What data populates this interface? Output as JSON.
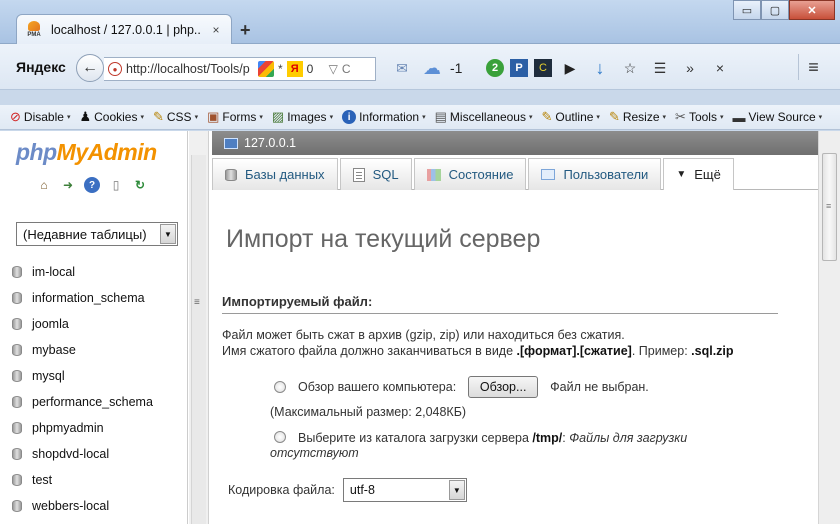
{
  "browser": {
    "tab_title": "localhost / 127.0.0.1 | php...",
    "tab_close": "×",
    "new_tab": "+",
    "favicon_text": "PMA",
    "window_controls": {
      "minimize": "▭",
      "maximize": "▢",
      "close": "✕"
    },
    "brand": "Яндекс",
    "back": "←",
    "url": "http://localhost/Tools/p",
    "url_icons": {
      "site": "●",
      "star": "*",
      "ya": "Я",
      "count": "0",
      "dropdown": "▽",
      "reload": "C"
    },
    "toolbar": {
      "mail": "✉",
      "weather": "☁",
      "weather_value": "-1",
      "green_badge": "2",
      "p_badge": "P",
      "c_badge": "C",
      "play": "▶",
      "download": "↓",
      "bookmark": "☆",
      "clipboard": "☰",
      "more": "»",
      "close": "×"
    },
    "menu": "≡"
  },
  "devbar": {
    "items": [
      {
        "label": "Disable",
        "icon": "⊘"
      },
      {
        "label": "Cookies",
        "icon": "♟"
      },
      {
        "label": "CSS",
        "icon": "✎"
      },
      {
        "label": "Forms",
        "icon": "▣"
      },
      {
        "label": "Images",
        "icon": "▨"
      },
      {
        "label": "Information",
        "icon": "i"
      },
      {
        "label": "Miscellaneous",
        "icon": "▤"
      },
      {
        "label": "Outline",
        "icon": "✎"
      },
      {
        "label": "Resize",
        "icon": "✎"
      },
      {
        "label": "Tools",
        "icon": "✂"
      },
      {
        "label": "View Source",
        "icon": "▬"
      }
    ],
    "arrow": "▾"
  },
  "sidebar": {
    "logo_part1": "php",
    "logo_part2": "MyAdmin",
    "icons": {
      "home": "⌂",
      "exit": "➜",
      "help": "?",
      "docs": "▯",
      "reload": "↻"
    },
    "recent_select": "(Недавние таблицы)",
    "dropdown_arrow": "▼",
    "databases": [
      "im-local",
      "information_schema",
      "joomla",
      "mybase",
      "mysql",
      "performance_schema",
      "phpmyadmin",
      "shopdvd-local",
      "test",
      "webbers-local"
    ]
  },
  "splitter": {
    "grip": "≡"
  },
  "main": {
    "server": "127.0.0.1",
    "tabs": [
      {
        "label": "Базы данных"
      },
      {
        "label": "SQL"
      },
      {
        "label": "Состояние"
      },
      {
        "label": "Пользователи"
      },
      {
        "label": "Ещё",
        "arrow": "▼"
      }
    ],
    "heading": "Импорт на текущий сервер",
    "section_title": "Импортируемый файл:",
    "desc_line1": "Файл может быть сжат в архив (gzip, zip) или находиться без сжатия.",
    "desc_line2_pre": "Имя сжатого файла должно заканчиваться в виде ",
    "desc_line2_bold": ".[формат].[сжатие]",
    "desc_line2_mid": ". Пример: ",
    "desc_line2_example": ".sql.zip",
    "browse_label": "Обзор вашего компьютера:",
    "browse_button": "Обзор...",
    "file_status": "Файл не выбран.",
    "max_size": "(Максимальный размер: 2,048КБ)",
    "server_label_pre": "Выберите из каталога загрузки сервера ",
    "server_dir": "/tmp/",
    "server_colon": ":",
    "server_no_files_1": "Файлы для загрузки",
    "server_no_files_2": "отсутствуют",
    "charset_label": "Кодировка файла:",
    "charset_value": "utf-8",
    "dropdown_arrow": "▼"
  },
  "scrollbar": {
    "grip": "≡"
  }
}
